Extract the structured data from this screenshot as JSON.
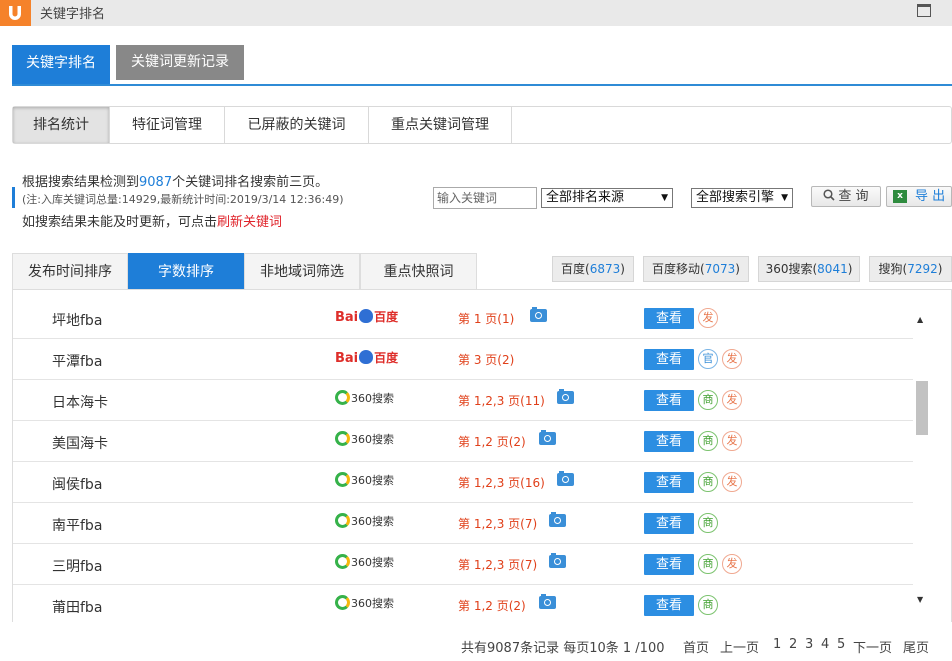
{
  "window": {
    "title": "关键字排名"
  },
  "main_tabs": [
    {
      "label": "关键字排名",
      "active": true
    },
    {
      "label": "关键词更新记录",
      "active": false
    }
  ],
  "sub_tabs": [
    {
      "label": "排名统计",
      "active": true
    },
    {
      "label": "特征词管理",
      "active": false
    },
    {
      "label": "已屏蔽的关键词",
      "active": false
    },
    {
      "label": "重点关键词管理",
      "active": false
    }
  ],
  "info": {
    "line1_prefix": "根据搜索结果检测到",
    "line1_count": "9087",
    "line1_suffix": "个关键词排名搜索前三页。",
    "line2": "(注:入库关键词总量:14929,最新统计时间:2019/3/14 12:36:49)",
    "line3_prefix": "如搜索结果未能及时更新，可点击",
    "line3_link": "刷新关键词"
  },
  "filters": {
    "keyword_placeholder": "输入关键词",
    "rank_source": "全部排名来源",
    "search_engine": "全部搜索引擎",
    "query_label": "查 询",
    "export_label": "导 出"
  },
  "list_tabs": [
    {
      "label": "发布时间排序",
      "active": false
    },
    {
      "label": "字数排序",
      "active": true
    },
    {
      "label": "非地域词筛选",
      "active": false
    },
    {
      "label": "重点快照词",
      "active": false
    }
  ],
  "engines": [
    {
      "name": "百度",
      "count": "6873"
    },
    {
      "name": "百度移动",
      "count": "7073"
    },
    {
      "name": "360搜索",
      "count": "8041"
    },
    {
      "name": "搜狗",
      "count": "7292"
    }
  ],
  "rows": [
    {
      "keyword": "坪地fba",
      "engine": "baidu",
      "rank": "第 1 页(1)",
      "has_snapshot": true,
      "view": "查看",
      "badges": [
        "发"
      ]
    },
    {
      "keyword": "平潭fba",
      "engine": "baidu",
      "rank": "第 3 页(2)",
      "has_snapshot": false,
      "view": "查看",
      "badges": [
        "官",
        "发"
      ]
    },
    {
      "keyword": "日本海卡",
      "engine": "360",
      "rank": "第 1,2,3 页(11)",
      "has_snapshot": true,
      "view": "查看",
      "badges": [
        "商",
        "发"
      ]
    },
    {
      "keyword": "美国海卡",
      "engine": "360",
      "rank": "第 1,2 页(2)",
      "has_snapshot": true,
      "view": "查看",
      "badges": [
        "商",
        "发"
      ]
    },
    {
      "keyword": "闽侯fba",
      "engine": "360",
      "rank": "第 1,2,3 页(16)",
      "has_snapshot": true,
      "view": "查看",
      "badges": [
        "商",
        "发"
      ]
    },
    {
      "keyword": "南平fba",
      "engine": "360",
      "rank": "第 1,2,3 页(7)",
      "has_snapshot": true,
      "view": "查看",
      "badges": [
        "商"
      ]
    },
    {
      "keyword": "三明fba",
      "engine": "360",
      "rank": "第 1,2,3 页(7)",
      "has_snapshot": true,
      "view": "查看",
      "badges": [
        "商",
        "发"
      ]
    },
    {
      "keyword": "莆田fba",
      "engine": "360",
      "rank": "第 1,2 页(2)",
      "has_snapshot": true,
      "view": "查看",
      "badges": [
        "商"
      ]
    }
  ],
  "logos": {
    "baidu_bai": "Bai",
    "baidu_du": "百度",
    "s360": "360搜索"
  },
  "pager": {
    "summary": "共有9087条记录 每页10条 1 /100",
    "first": "首页",
    "prev": "上一页",
    "pages": [
      "1",
      "2",
      "3",
      "4",
      "5"
    ],
    "current": "1",
    "next": "下一页",
    "last": "尾页"
  },
  "colors": {
    "accent": "#1e7ed8",
    "link_red": "#e0232a",
    "rank_red": "#e0401a"
  }
}
